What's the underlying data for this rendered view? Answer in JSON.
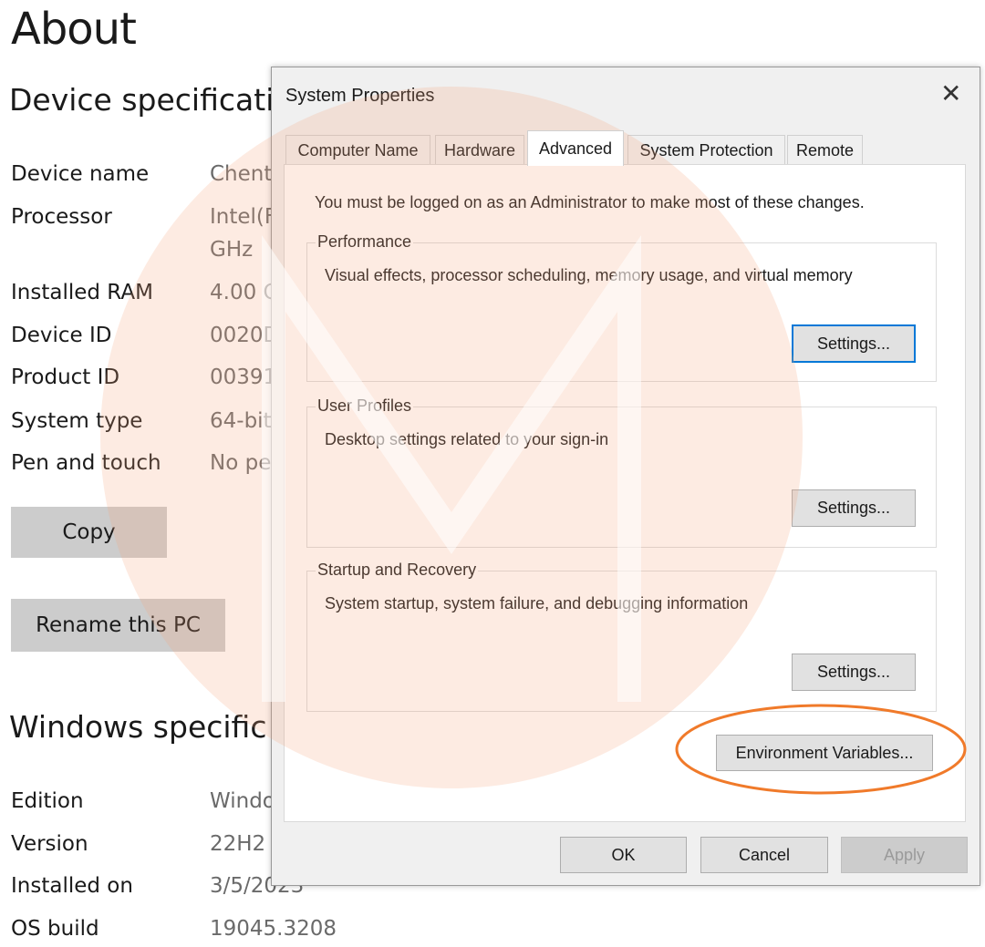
{
  "about": {
    "title": "About",
    "device_heading": "Device specificati",
    "windows_heading": "Windows specific",
    "device_specs": [
      {
        "label": "Device name",
        "value": "Chent"
      },
      {
        "label": "Processor",
        "value": "Intel(F",
        "value2": "GHz"
      },
      {
        "label": "Installed RAM",
        "value": "4.00 C"
      },
      {
        "label": "Device ID",
        "value": "0020D"
      },
      {
        "label": "Product ID",
        "value": "00391"
      },
      {
        "label": "System type",
        "value": "64-bit"
      },
      {
        "label": "Pen and touch",
        "value": "No pe"
      }
    ],
    "copy_label": "Copy",
    "rename_label": "Rename this PC",
    "windows_specs": [
      {
        "label": "Edition",
        "value": "Windo"
      },
      {
        "label": "Version",
        "value": "22H2"
      },
      {
        "label": "Installed on",
        "value": "3/5/2023"
      },
      {
        "label": "OS build",
        "value": "19045.3208"
      }
    ]
  },
  "dialog": {
    "title": "System Properties",
    "close_icon": "close-icon",
    "tabs": [
      {
        "label": "Computer Name"
      },
      {
        "label": "Hardware"
      },
      {
        "label": "Advanced",
        "selected": true
      },
      {
        "label": "System Protection"
      },
      {
        "label": "Remote"
      }
    ],
    "admin_note": "You must be logged on as an Administrator to make most of these changes.",
    "groups": [
      {
        "label": "Performance",
        "desc": "Visual effects, processor scheduling, memory usage, and virtual memory",
        "button": "Settings..."
      },
      {
        "label": "User Profiles",
        "desc": "Desktop settings related to your sign-in",
        "button": "Settings..."
      },
      {
        "label": "Startup and Recovery",
        "desc": "System startup, system failure, and debugging information",
        "button": "Settings..."
      }
    ],
    "env_button": "Environment Variables...",
    "ok": "OK",
    "cancel": "Cancel",
    "apply": "Apply"
  },
  "watermark": {
    "logo_text": "M"
  },
  "colors": {
    "highlight_ellipse": "#f07a2a",
    "watermark": "#fbe3d6",
    "default_button_border": "#0078d7"
  }
}
